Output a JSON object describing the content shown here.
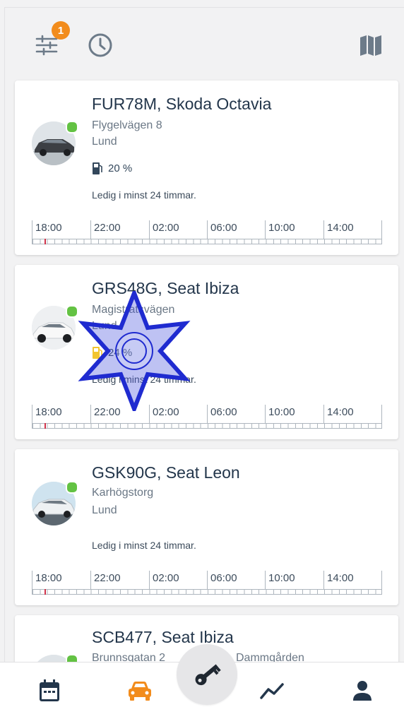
{
  "topbar": {
    "filter_badge": "1",
    "icons": [
      "filter-icon",
      "clock-icon",
      "map-icon"
    ]
  },
  "cars": [
    {
      "title": "FUR78M, Skoda Octavia",
      "street": "Flygelvägen 8",
      "city": "Lund",
      "fuel": "20 %",
      "availability": "Ledig i minst 24 timmar.",
      "status_color": "#63c243",
      "car_color": "dark grey"
    },
    {
      "title": "GRS48G, Seat Ibiza",
      "street": "Magistratsvägen",
      "city": "Lund",
      "fuel": "24 %",
      "availability": "Ledig i minst 24 timmar.",
      "status_color": "#63c243",
      "car_color": "white"
    },
    {
      "title": "GSK90G, Seat Leon",
      "street": "Karhögstorg",
      "city": "Lund",
      "availability": "Ledig i minst 24 timmar.",
      "status_color": "#63c243",
      "car_color": "white"
    },
    {
      "title": "SCB477, Seat Ibiza",
      "street": "Brunnsgatan 2",
      "street_extra": "Dammgården",
      "status_color": "#63c243"
    }
  ],
  "timeline": {
    "labels": [
      "18:00",
      "22:00",
      "02:00",
      "06:00",
      "10:00",
      "14:00"
    ]
  },
  "bottom_nav": {
    "items": [
      "calendar-icon",
      "car-icon",
      "key-icon",
      "chart-icon",
      "person-icon"
    ],
    "active": "car-icon",
    "active_color": "#f28c1c"
  }
}
